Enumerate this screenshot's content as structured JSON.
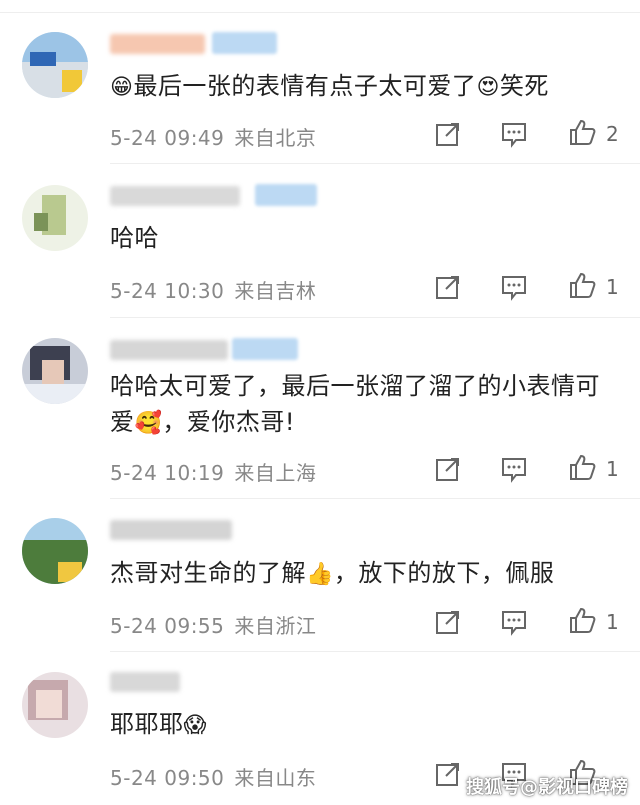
{
  "comments": [
    {
      "text": "最后一张的表情有点子太可爱了",
      "text_suffix": "笑死",
      "lead_emoji": "😁",
      "mid_emoji": "😍",
      "date": "5-24 09:49",
      "location": "来自北京",
      "likes": "2"
    },
    {
      "text": "哈哈",
      "date": "5-24 10:30",
      "location": "来自吉林",
      "likes": "1"
    },
    {
      "text": "哈哈太可爱了，最后一张溜了溜了的小表情可爱",
      "emoji": "🥰",
      "text_suffix": "，爱你杰哥!",
      "date": "5-24 10:19",
      "location": "来自上海",
      "likes": "1"
    },
    {
      "text": "杰哥对生命的了解",
      "emoji": "👍",
      "text_suffix": "，放下的放下，佩服",
      "date": "5-24 09:55",
      "location": "来自浙江",
      "likes": "1"
    },
    {
      "text": "耶耶耶",
      "emoji": "😱",
      "date": "5-24 09:50",
      "location": "来自山东",
      "likes": ""
    }
  ],
  "icons": {
    "share": "share-icon",
    "comment": "comment-icon",
    "like": "thumbs-up-icon"
  },
  "watermark": "搜狐号@影视口碑榜",
  "colors": {
    "text": "#222222",
    "meta": "#888888",
    "icon": "#666666",
    "separator": "#eeeeee"
  }
}
